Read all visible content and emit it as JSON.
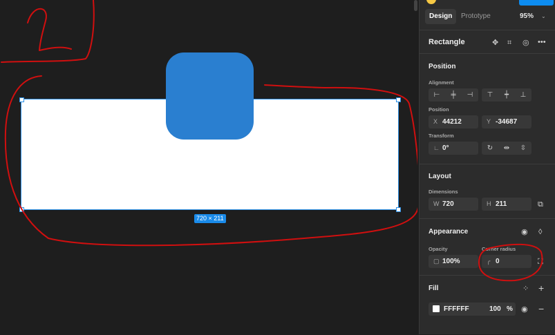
{
  "canvas": {
    "annotation_number": "2",
    "dimension_badge": "720 × 211"
  },
  "panel": {
    "tabs": [
      {
        "label": "Design",
        "active": true
      },
      {
        "label": "Prototype",
        "active": false
      }
    ],
    "zoom": "95%",
    "layer_name": "Rectangle",
    "position": {
      "title": "Position",
      "alignment_label": "Alignment",
      "position_label": "Position",
      "x_prefix": "X",
      "x_value": "44212",
      "y_prefix": "Y",
      "y_value": "-34687",
      "transform_label": "Transform",
      "rotation_value": "0°"
    },
    "layout": {
      "title": "Layout",
      "dimensions_label": "Dimensions",
      "w_prefix": "W",
      "w_value": "720",
      "h_prefix": "H",
      "h_value": "211"
    },
    "appearance": {
      "title": "Appearance",
      "opacity_label": "Opacity",
      "opacity_value": "100%",
      "corner_label": "Corner radius",
      "corner_value": "0"
    },
    "fill": {
      "title": "Fill",
      "hex": "FFFFFF",
      "opacity": "100",
      "percent": "%"
    }
  },
  "colors": {
    "accent": "#1a8bea",
    "annotation": "#d10f0f",
    "shape_blue": "#2a7fd0"
  }
}
